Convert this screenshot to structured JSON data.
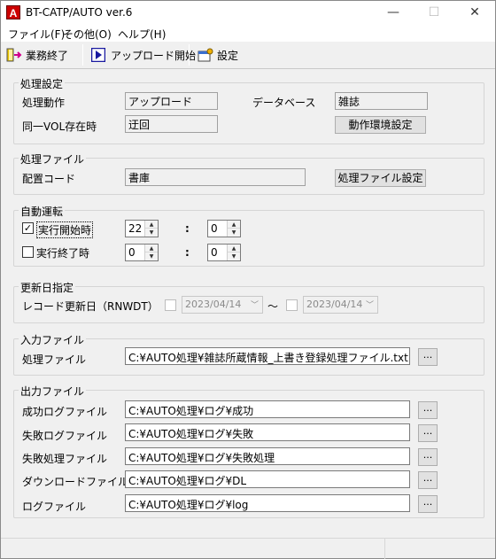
{
  "window": {
    "title": "BT-CATP/AUTO ver.6",
    "app_icon_letter": "A",
    "minimize": "—",
    "maximize": "☐",
    "close": "✕"
  },
  "menu": [
    "ファイル(F)",
    "その他(O)",
    "ヘルプ(H)"
  ],
  "toolbar": {
    "exit_label": "業務終了",
    "upload_label": "アップロード開始",
    "settings_label": "設定"
  },
  "processing_settings": {
    "title": "処理設定",
    "action_label": "処理動作",
    "action_value": "アップロード",
    "database_label": "データベース",
    "database_value": "雑誌",
    "vol_label": "同一VOL存在時",
    "vol_value": "迂回",
    "env_button": "動作環境設定"
  },
  "processing_file": {
    "title": "処理ファイル",
    "location_label": "配置コード",
    "location_value": "書庫",
    "file_settings_button": "処理ファイル設定"
  },
  "auto_run": {
    "title": "自動運転",
    "start_label": "実行開始時",
    "start_checked": "✓",
    "start_hour": "22",
    "start_min": "0",
    "end_label": "実行終了時",
    "end_hour": "0",
    "end_min": "0",
    "colon": ":"
  },
  "update_date": {
    "title": "更新日指定",
    "record_label": "レコード更新日（RNWDT）",
    "from_date": "2023/04/14",
    "tilde": "～",
    "to_date": "2023/04/14"
  },
  "input_file": {
    "title": "入力ファイル",
    "process_file_label": "処理ファイル",
    "process_file_value": "C:¥AUTO処理¥雑誌所蔵情報_上書き登録処理ファイル.txt",
    "browse": "..."
  },
  "output_file": {
    "title": "出力ファイル",
    "rows": [
      {
        "label": "成功ログファイル",
        "value": "C:¥AUTO処理¥ログ¥成功"
      },
      {
        "label": "失敗ログファイル",
        "value": "C:¥AUTO処理¥ログ¥失敗"
      },
      {
        "label": "失敗処理ファイル",
        "value": "C:¥AUTO処理¥ログ¥失敗処理"
      },
      {
        "label": "ダウンロードファイル",
        "value": "C:¥AUTO処理¥ログ¥DL"
      },
      {
        "label": "ログファイル",
        "value": "C:¥AUTO処理¥ログ¥log"
      }
    ],
    "browse": "..."
  },
  "icons": {
    "exit": "exit-door-icon",
    "upload": "play-arrow-icon",
    "settings": "settings-window-icon"
  }
}
